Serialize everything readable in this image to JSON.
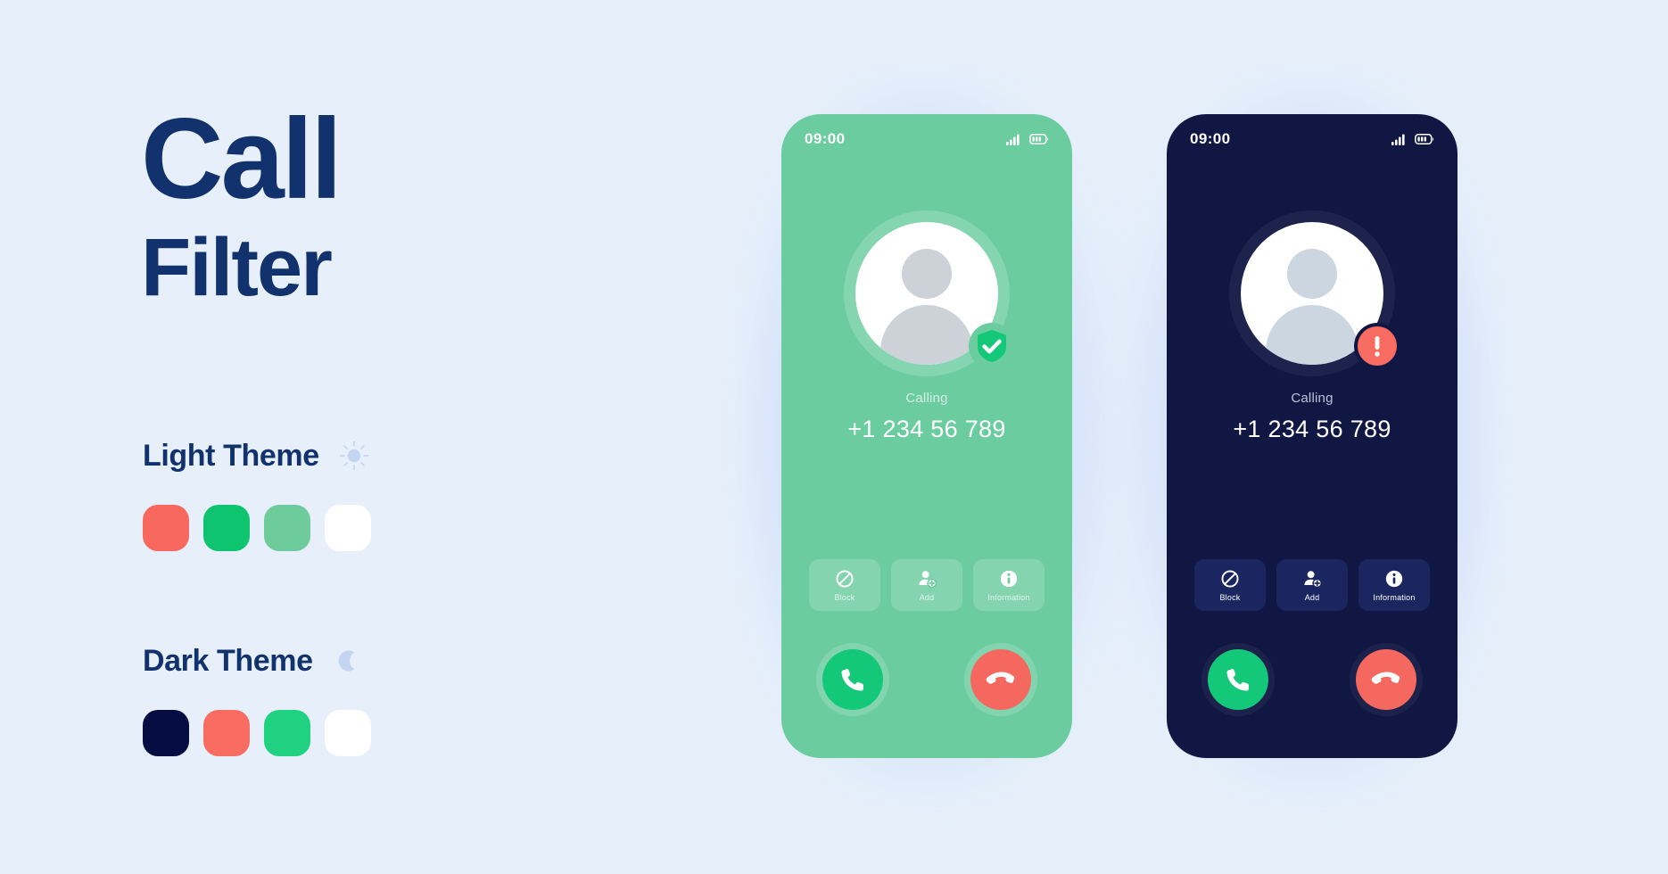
{
  "page": {
    "background_color": "#e7f0fa"
  },
  "heading": {
    "line1": "Call",
    "line2": "Filter",
    "color": "#12326e"
  },
  "themes": [
    {
      "id": "light",
      "label": "Light Theme",
      "icon": "sun-icon",
      "icon_color": "#c3d5f0",
      "swatches": [
        "#f9685f",
        "#0ec46f",
        "#6ecb9b",
        "#ffffff"
      ]
    },
    {
      "id": "dark",
      "label": "Dark Theme",
      "icon": "moon-icon",
      "icon_color": "#c3d5f0",
      "swatches": [
        "#060d42",
        "#f96c61",
        "#21d182",
        "#ffffff"
      ]
    }
  ],
  "screens": [
    {
      "id": "light-theme-call-screen",
      "theme": "light",
      "background_color": "#6bcca0",
      "status_bar": {
        "time": "09:00",
        "icons": [
          "signal-bars-icon",
          "battery-icon"
        ]
      },
      "avatar": {
        "icon": "user-avatar-icon",
        "badge": "shield-check-icon",
        "badge_color": "#13c878"
      },
      "call": {
        "status": "Calling",
        "number": "+1 234 56 789"
      },
      "actions": [
        {
          "label": "Block",
          "icon": "block-icon"
        },
        {
          "label": "Add",
          "icon": "person-add-icon"
        },
        {
          "label": "Information",
          "icon": "info-icon"
        }
      ],
      "controls": [
        {
          "name": "accept-call-button",
          "icon": "phone-icon",
          "color": "#13c878"
        },
        {
          "name": "decline-call-button",
          "icon": "phone-hangup-icon",
          "color": "#f5685f"
        }
      ]
    },
    {
      "id": "dark-theme-call-screen",
      "theme": "dark",
      "background_color": "#101743",
      "status_bar": {
        "time": "09:00",
        "icons": [
          "signal-bars-icon",
          "battery-icon"
        ]
      },
      "avatar": {
        "icon": "user-avatar-icon",
        "badge": "alert-exclamation-icon",
        "badge_color": "#f96c61"
      },
      "call": {
        "status": "Calling",
        "number": "+1 234 56 789"
      },
      "actions": [
        {
          "label": "Block",
          "icon": "block-icon"
        },
        {
          "label": "Add",
          "icon": "person-add-icon"
        },
        {
          "label": "Information",
          "icon": "info-icon"
        }
      ],
      "controls": [
        {
          "name": "accept-call-button",
          "icon": "phone-icon",
          "color": "#13c878"
        },
        {
          "name": "decline-call-button",
          "icon": "phone-hangup-icon",
          "color": "#f5685f"
        }
      ]
    }
  ]
}
